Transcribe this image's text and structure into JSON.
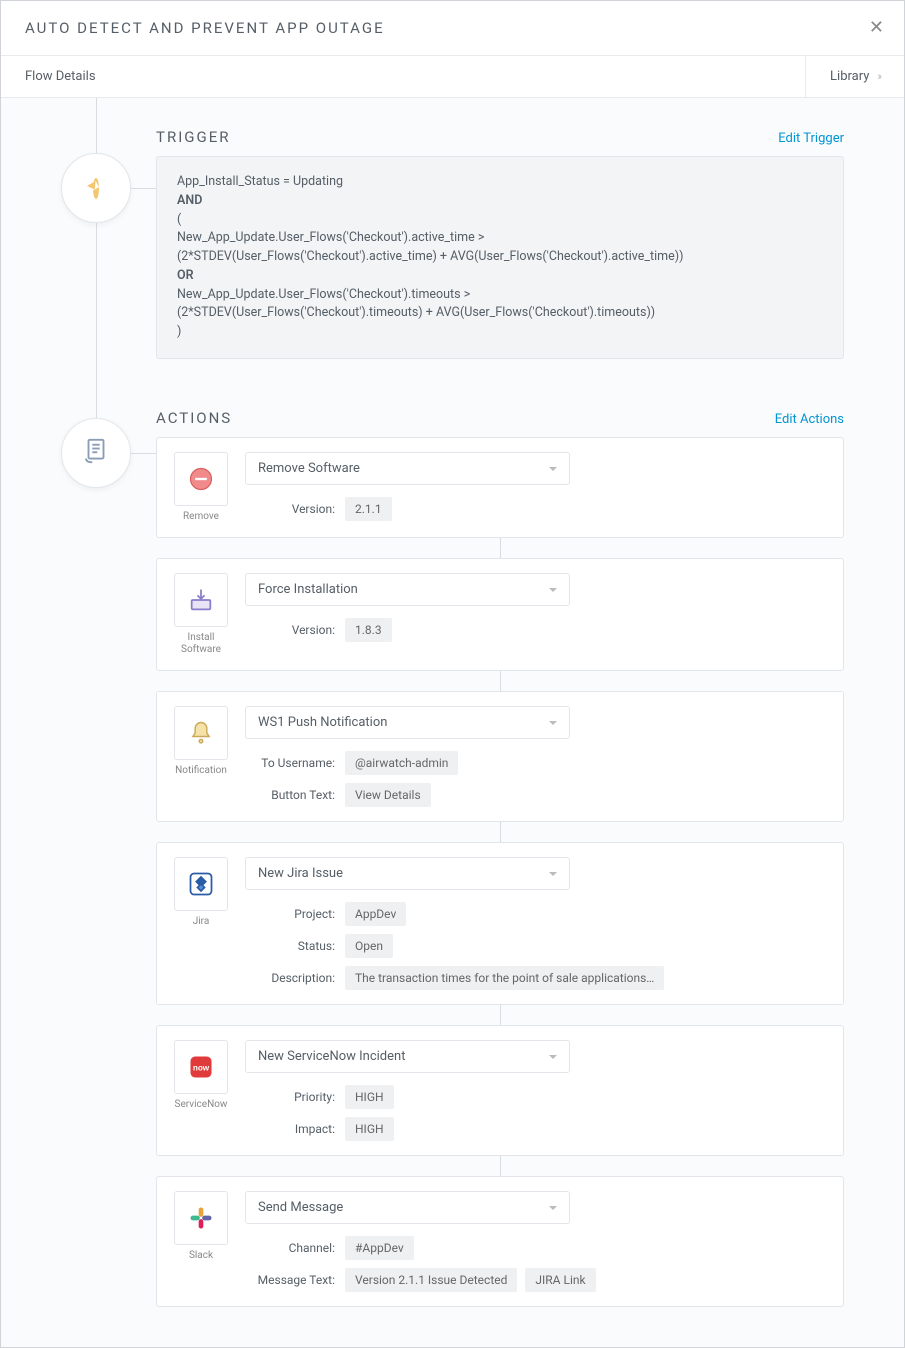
{
  "modal": {
    "title": "AUTO DETECT AND PREVENT APP OUTAGE"
  },
  "tabs": {
    "left": "Flow Details",
    "right": "Library"
  },
  "trigger": {
    "header": "TRIGGER",
    "edit": "Edit Trigger",
    "line1": "App_Install_Status = Updating",
    "and": "AND",
    "open": "(",
    "line2": "New_App_Update.User_Flows('Checkout').active_time >",
    "line3": "(2*STDEV(User_Flows('Checkout').active_time) + AVG(User_Flows('Checkout').active_time))",
    "or": "OR",
    "line4": "New_App_Update.User_Flows('Checkout').timeouts >",
    "line5": "(2*STDEV(User_Flows('Checkout').timeouts) + AVG(User_Flows('Checkout').timeouts))",
    "close": ")"
  },
  "actions": {
    "header": "ACTIONS",
    "edit": "Edit Actions",
    "items": [
      {
        "icon_label": "Remove",
        "dropdown": "Remove Software",
        "fields": [
          {
            "label": "Version:",
            "values": [
              "2.1.1"
            ]
          }
        ]
      },
      {
        "icon_label": "Install Software",
        "dropdown": "Force Installation",
        "fields": [
          {
            "label": "Version:",
            "values": [
              "1.8.3"
            ]
          }
        ]
      },
      {
        "icon_label": "Notification",
        "dropdown": "WS1 Push Notification",
        "fields": [
          {
            "label": "To Username:",
            "values": [
              "@airwatch-admin"
            ]
          },
          {
            "label": "Button Text:",
            "values": [
              "View Details"
            ]
          }
        ]
      },
      {
        "icon_label": "Jira",
        "dropdown": "New Jira Issue",
        "fields": [
          {
            "label": "Project:",
            "values": [
              "AppDev"
            ]
          },
          {
            "label": "Status:",
            "values": [
              "Open"
            ]
          },
          {
            "label": "Description:",
            "values": [
              "The transaction times for the point of sale applications…"
            ]
          }
        ]
      },
      {
        "icon_label": "ServiceNow",
        "dropdown": "New ServiceNow Incident",
        "fields": [
          {
            "label": "Priority:",
            "values": [
              "HIGH"
            ]
          },
          {
            "label": "Impact:",
            "values": [
              "HIGH"
            ]
          }
        ]
      },
      {
        "icon_label": "Slack",
        "dropdown": "Send Message",
        "fields": [
          {
            "label": "Channel:",
            "values": [
              "#AppDev"
            ]
          },
          {
            "label": "Message Text:",
            "values": [
              "Version 2.1.1 Issue Detected",
              "JIRA Link"
            ]
          }
        ]
      }
    ]
  }
}
